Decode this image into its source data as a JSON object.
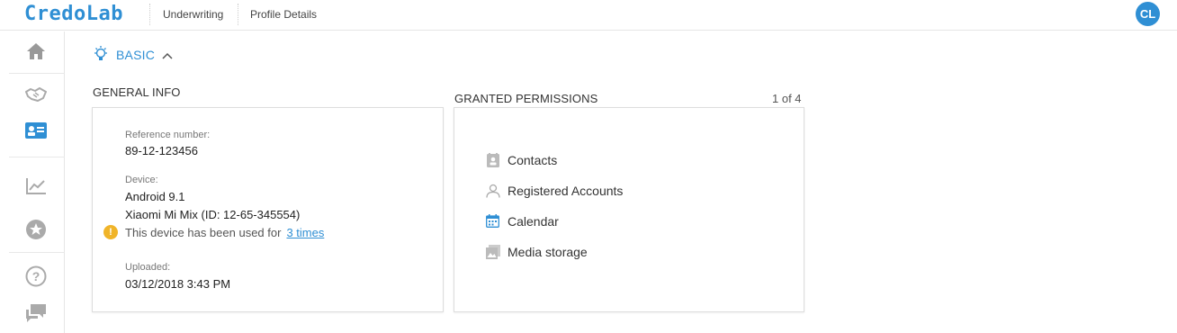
{
  "app": {
    "logo_text": "CredoLab"
  },
  "header": {
    "breadcrumbs": [
      "Underwriting",
      "Profile Details"
    ],
    "avatar_initials": "CL"
  },
  "sidebar": {
    "items": [
      {
        "icon": "home-icon",
        "active": false
      },
      {
        "icon": "handshake-icon",
        "active": false
      },
      {
        "icon": "profile-card-icon",
        "active": true
      },
      {
        "icon": "chart-icon",
        "active": false
      },
      {
        "icon": "star-icon",
        "active": false
      },
      {
        "icon": "help-icon",
        "active": false
      },
      {
        "icon": "chat-icon",
        "active": false
      }
    ]
  },
  "section": {
    "label": "BASIC",
    "icon": "lightbulb-icon",
    "expanded": true
  },
  "general_info": {
    "title": "GENERAL INFO",
    "reference_label": "Reference number:",
    "reference_value": "89-12-123456",
    "device_label": "Device:",
    "device_os": "Android 9.1",
    "device_model": "Xiaomi Mi Mix (ID: 12-65-345554)",
    "warning_text": "This device has been used for",
    "warning_link": "3 times",
    "uploaded_label": "Uploaded:",
    "uploaded_value": "03/12/2018 3:43 PM"
  },
  "permissions": {
    "title": "GRANTED PERMISSIONS",
    "pager": "1 of 4",
    "items": [
      {
        "label": "Contacts",
        "icon": "contacts-icon"
      },
      {
        "label": "Registered Accounts",
        "icon": "person-icon"
      },
      {
        "label": "Calendar",
        "icon": "calendar-icon"
      },
      {
        "label": "Media storage",
        "icon": "media-icon"
      }
    ]
  },
  "colors": {
    "accent": "#2f8fd4",
    "warning": "#f0b429"
  }
}
